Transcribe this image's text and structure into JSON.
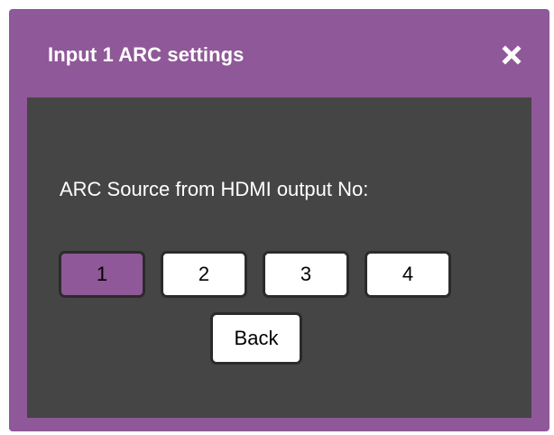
{
  "dialog": {
    "title": "Input 1 ARC settings",
    "close_icon": "close-icon",
    "prompt": "ARC Source from HDMI output No:",
    "output_buttons": [
      {
        "label": "1",
        "selected": true
      },
      {
        "label": "2",
        "selected": false
      },
      {
        "label": "3",
        "selected": false
      },
      {
        "label": "4",
        "selected": false
      }
    ],
    "back_label": "Back"
  },
  "colors": {
    "accent": "#8f5898",
    "panel": "#464545",
    "button_border": "#2c2b2b",
    "button_bg": "#ffffff"
  }
}
